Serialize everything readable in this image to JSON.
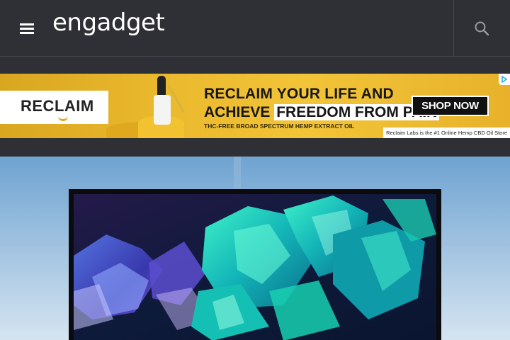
{
  "header": {
    "logo_text": "engadget",
    "menu_icon": "hamburger-menu-icon",
    "search_icon": "search-icon",
    "background_color": "#2f3035"
  },
  "ad": {
    "brand": "RECLAIM",
    "headline_line1": "RECLAIM YOUR LIFE AND",
    "headline_line2_prefix": "ACHIEVE",
    "headline_line2_highlight": "FREEDOM FROM PAIN",
    "subline": "THC-FREE BROAD SPECTRUM HEMP EXTRACT OIL",
    "cta": "SHOP NOW",
    "footer": "Reclaim Labs is the #1 Online Hemp CBD Oil Store",
    "adchoices_icon": "adchoices-icon",
    "accent_color": "#eab82c"
  },
  "hero": {
    "image": "tv-crystals-photo"
  }
}
